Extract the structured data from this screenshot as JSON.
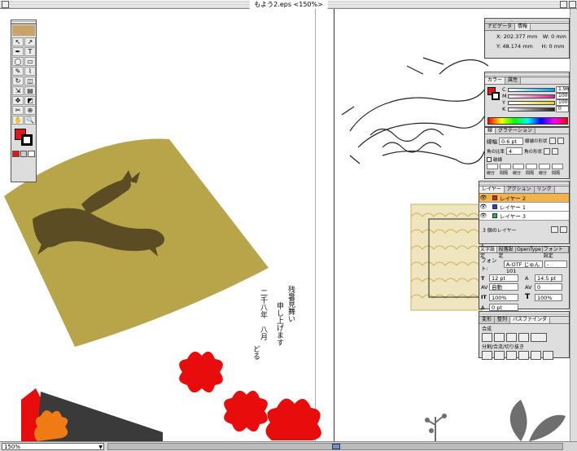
{
  "window": {
    "title": "もよう2.eps <150%>"
  },
  "statusbar": {
    "zoom": "150%"
  },
  "toolbox": {
    "tools": [
      "↖",
      "↗",
      "✒",
      "T",
      "◯",
      "▭",
      "✎",
      "⌇",
      "↻",
      "◫",
      "⇲",
      "▤",
      "✥",
      "◩",
      "✂",
      "⊕",
      "✋",
      "🔍"
    ]
  },
  "card_text": {
    "line1": "残暑見舞い",
    "line2": "申し上げます",
    "line3": "二千八年　八月",
    "line4": "どる"
  },
  "info_palette": {
    "tabs": [
      "ナビゲータ",
      "情報"
    ],
    "x_label": "X:",
    "x_value": "202.377 mm",
    "y_label": "Y:",
    "y_value": "48.174 mm",
    "w_label": "W:",
    "w_value": "0 mm",
    "h_label": "H:",
    "h_value": "0 mm"
  },
  "color_palette": {
    "tabs": [
      "カラー",
      "属性"
    ],
    "channels": [
      {
        "label": "C",
        "value": "1.96",
        "color": "#00a0e0"
      },
      {
        "label": "M",
        "value": "100",
        "color": "#e0208a"
      },
      {
        "label": "Y",
        "value": "100",
        "color": "#e8d800"
      },
      {
        "label": "K",
        "value": "0",
        "color": "#222222"
      }
    ]
  },
  "stroke_palette": {
    "tabs": [
      "線",
      "グラデーション"
    ],
    "weight_label": "線幅",
    "weight_value": "0.6 pt",
    "cap_label": "線端の形状",
    "miter_label": "角の比率",
    "miter_value": "4",
    "join_label": "角の形状",
    "dash_label": "破線",
    "dash_fields": [
      "線分",
      "間隔",
      "線分",
      "間隔",
      "線分",
      "間隔"
    ]
  },
  "layers_palette": {
    "tabs": [
      "レイヤー",
      "アクション",
      "リンク"
    ],
    "layers": [
      {
        "name": "レイヤー 2",
        "color": "#e02020",
        "selected": true
      },
      {
        "name": "レイヤー 1",
        "color": "#2040e0",
        "selected": false
      },
      {
        "name": "レイヤー 3",
        "color": "#20c040",
        "selected": false
      }
    ],
    "count_label": "3 個のレイヤー"
  },
  "char_palette": {
    "tabs": [
      "文字設定",
      "段落設定",
      "OpenType",
      "フォント設定"
    ],
    "font_label": "フォント:",
    "font_value": "A-OTF じゅん101",
    "style_value": "-",
    "size_value": "12 pt",
    "leading_value": "14.5 pt",
    "tracking_value": "自動",
    "kerning_value": "0",
    "vscale_value": "100%",
    "hscale_value": "100%",
    "baseline_value": "0 pt"
  },
  "pathfinder_palette": {
    "tabs": [
      "変形",
      "整列",
      "パスファインダ"
    ],
    "combine_label": "合成",
    "divide_label": "分割/合流/切り抜き"
  }
}
